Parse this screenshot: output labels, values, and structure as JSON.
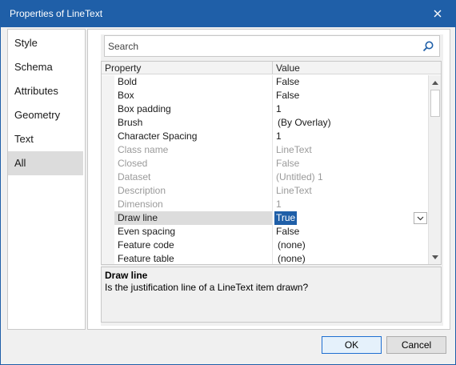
{
  "window": {
    "title": "Properties of LineText"
  },
  "sidebar": {
    "items": [
      {
        "label": "Style"
      },
      {
        "label": "Schema"
      },
      {
        "label": "Attributes"
      },
      {
        "label": "Geometry"
      },
      {
        "label": "Text"
      },
      {
        "label": "All",
        "active": true
      }
    ]
  },
  "search": {
    "placeholder": "Search"
  },
  "grid": {
    "headers": {
      "property": "Property",
      "value": "Value"
    },
    "rows": [
      {
        "name": "Bold",
        "value": "False"
      },
      {
        "name": "Box",
        "value": "False"
      },
      {
        "name": "Box padding",
        "value": "1"
      },
      {
        "name": "Brush",
        "value": "(By Overlay)"
      },
      {
        "name": "Character Spacing",
        "value": "1"
      },
      {
        "name": "Class name",
        "value": "LineText",
        "disabled": true
      },
      {
        "name": "Closed",
        "value": "False",
        "disabled": true
      },
      {
        "name": "Dataset",
        "value": "(Untitled) 1",
        "disabled": true
      },
      {
        "name": "Description",
        "value": "LineText",
        "disabled": true
      },
      {
        "name": "Dimension",
        "value": "1",
        "disabled": true
      },
      {
        "name": "Draw line",
        "value": "True",
        "selected": true
      },
      {
        "name": "Even spacing",
        "value": "False"
      },
      {
        "name": "Feature code",
        "value": "(none)"
      },
      {
        "name": "Feature table",
        "value": "(none)"
      }
    ]
  },
  "help": {
    "title": "Draw line",
    "description": "Is the justification line of a LineText item drawn?"
  },
  "buttons": {
    "ok": "OK",
    "cancel": "Cancel"
  },
  "colors": {
    "titlebar": "#1f5fa8",
    "accent": "#1f5fa8",
    "selection_bg": "#1f5fa8"
  }
}
